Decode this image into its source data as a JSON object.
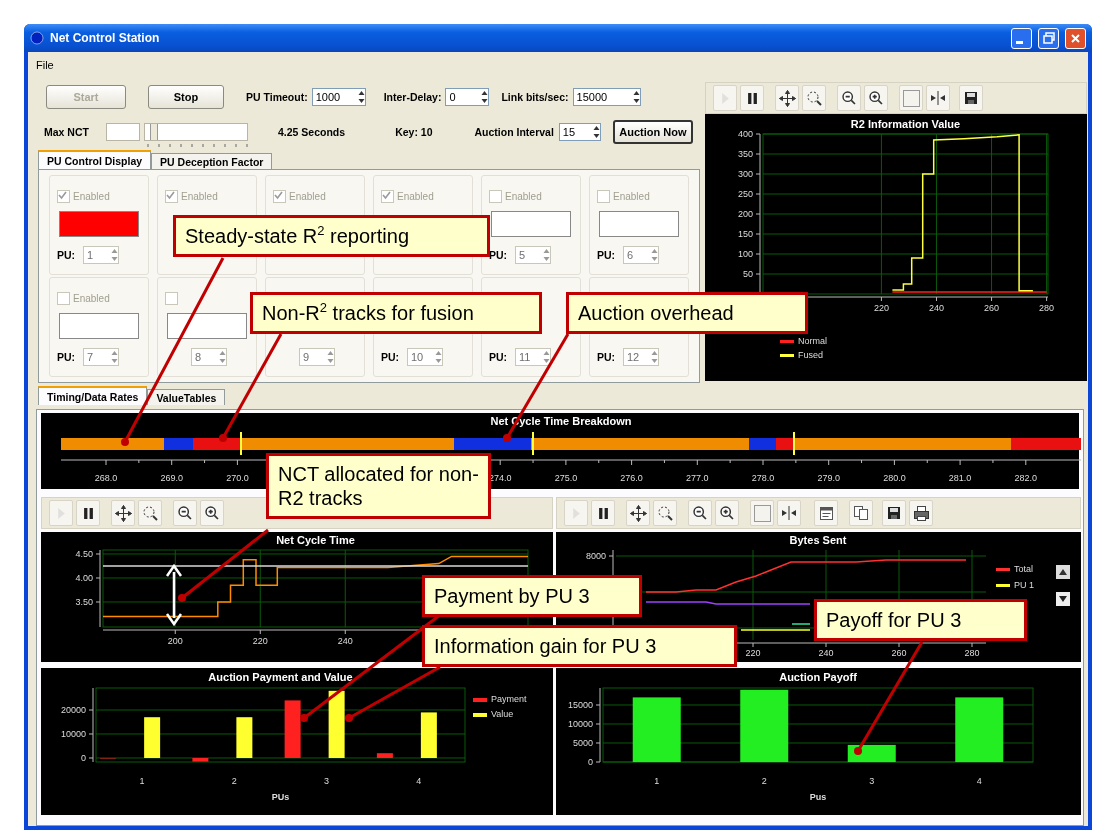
{
  "window": {
    "title": "Net Control Station"
  },
  "menu": [
    "File"
  ],
  "controls": {
    "start": {
      "label": "Start",
      "disabled": true
    },
    "stop": {
      "label": "Stop",
      "disabled": false
    },
    "pu_timeout": {
      "label": "PU Timeout:",
      "value": "1000"
    },
    "inter_delay": {
      "label": "Inter-Delay:",
      "value": "0"
    },
    "link_bits": {
      "label": "Link bits/sec:",
      "value": "15000"
    },
    "max_nct": {
      "label": "Max NCT",
      "level": 0.05,
      "reading": "4.25 Seconds"
    },
    "key": "Key: 10",
    "auction_interval": {
      "label": "Auction Interval",
      "value": "15"
    },
    "auction_now": {
      "label": "Auction Now"
    }
  },
  "top_tabs": [
    {
      "label": "PU Control Display",
      "selected": true
    },
    {
      "label": "PU Deception Factor",
      "selected": false
    }
  ],
  "pu_cells": [
    {
      "enabled_label": "Enabled",
      "checked": true,
      "color": "#ff0000",
      "pu_label": "PU:",
      "value": "1"
    },
    {
      "enabled_label": "Enabled",
      "checked": true
    },
    {
      "enabled_label": "Enabled",
      "checked": true
    },
    {
      "enabled_label": "Enabled",
      "checked": true
    },
    {
      "enabled_label": "Enabled",
      "checked": false,
      "color": "#ffffff",
      "pu_label": "PU:",
      "value": "5"
    },
    {
      "enabled_label": "Enabled",
      "checked": false,
      "color": "#ffffff",
      "pu_label": "PU:",
      "value": "6"
    },
    {
      "enabled_label": "Enabled",
      "checked": false,
      "color": "#ffffff",
      "pu_label": "PU:",
      "value": "7"
    },
    {
      "checked": false,
      "color": "#ffffff",
      "value": "8"
    },
    {
      "value": "9"
    },
    {
      "pu_label": "PU:",
      "value": "10"
    },
    {
      "pu_label": "PU:",
      "value": "11"
    },
    {
      "pu_label": "PU:",
      "value": "12"
    }
  ],
  "bottom_tabs": [
    {
      "label": "Timing/Data Rates",
      "selected": true
    },
    {
      "label": "ValueTables",
      "selected": false
    }
  ],
  "r2_panel": {
    "toolbar": [
      {
        "kind": "play",
        "disabled": true
      },
      {
        "kind": "pause",
        "disabled": false
      },
      {
        "kind": "move",
        "disabled": false
      },
      {
        "kind": "zoom-area",
        "disabled": false
      },
      {
        "kind": "zoom-out",
        "disabled": false
      },
      {
        "kind": "zoom-in",
        "disabled": false
      },
      {
        "kind": "blank",
        "disabled": false
      },
      {
        "kind": "split",
        "disabled": false
      },
      {
        "kind": "save",
        "disabled": false
      }
    ],
    "chart_data": {
      "type": "line",
      "title": "R2 Information Value",
      "grid": true,
      "legend": "bottom",
      "x": [
        224,
        228,
        228,
        231,
        231,
        235,
        235,
        239,
        239,
        250,
        262,
        270,
        270,
        275,
        280
      ],
      "xlim": [
        177,
        280.5
      ],
      "ylim": [
        0,
        400
      ],
      "xticks": [
        220,
        240,
        260,
        280
      ],
      "yticks": [
        50,
        100,
        150,
        200,
        250,
        300,
        350,
        400
      ],
      "series": [
        {
          "name": "Normal",
          "color": "#ff2020",
          "values": [
            5,
            5,
            5,
            5,
            5,
            5,
            5,
            5,
            5,
            5,
            5,
            5,
            5,
            5,
            5
          ]
        },
        {
          "name": "Fused",
          "color": "#ffff40",
          "values": [
            10,
            10,
            25,
            25,
            90,
            90,
            300,
            300,
            385,
            388,
            393,
            398,
            8,
            8,
            null
          ]
        }
      ]
    }
  },
  "timeline": {
    "title": "Net Cycle Time Breakdown",
    "tick_labels": [
      "268.0",
      "269.0",
      "270.0",
      "274.0",
      "275.0",
      "276.0",
      "277.0",
      "278.0",
      "279.0",
      "280.0",
      "281.0",
      "282.0"
    ]
  },
  "nct_panel": {
    "toolbar": [
      {
        "kind": "play",
        "disabled": true
      },
      {
        "kind": "pause",
        "disabled": false
      },
      {
        "kind": "move",
        "disabled": false
      },
      {
        "kind": "zoom-area",
        "disabled": false
      },
      {
        "kind": "zoom-out",
        "disabled": false
      },
      {
        "kind": "zoom-in",
        "disabled": false
      }
    ],
    "chart_data": {
      "type": "line",
      "title": "Net Cycle Time",
      "grid": true,
      "x": [
        183,
        210,
        210,
        213,
        213,
        216,
        216,
        219,
        219,
        224,
        224,
        250,
        262,
        265,
        283
      ],
      "xlim": [
        183,
        283
      ],
      "ylim": [
        2.979,
        4.583
      ],
      "xticks": [
        200,
        220,
        240
      ],
      "yticks": [
        {
          "value": 3.5,
          "label": "3.50"
        },
        {
          "value": 4,
          "label": "4.00"
        },
        {
          "value": 4.5,
          "label": "4.50"
        }
      ],
      "series": [
        {
          "color": "#ff8c00",
          "values": [
            3.2,
            3.2,
            3.5,
            3.5,
            3.85,
            3.85,
            4.38,
            4.38,
            3.85,
            3.85,
            4.22,
            4.22,
            4.3,
            4.45,
            4.45
          ]
        },
        {
          "color": "#d8d8d8",
          "values": [
            4.25,
            4.25,
            4.25,
            4.25,
            4.25,
            4.25,
            4.25,
            4.25,
            4.25,
            4.25,
            4.25,
            4.25,
            4.25,
            4.25,
            4.25
          ]
        }
      ]
    }
  },
  "bytes_panel": {
    "toolbar": [
      {
        "kind": "play",
        "disabled": true
      },
      {
        "kind": "pause",
        "disabled": false
      },
      {
        "kind": "move",
        "disabled": false
      },
      {
        "kind": "zoom-area",
        "disabled": false
      },
      {
        "kind": "zoom-out",
        "disabled": false
      },
      {
        "kind": "zoom-in",
        "disabled": false
      },
      {
        "kind": "blank",
        "disabled": false
      },
      {
        "kind": "split",
        "disabled": false
      },
      {
        "kind": "properties",
        "disabled": false
      },
      {
        "kind": "copy",
        "disabled": false
      },
      {
        "kind": "save",
        "disabled": false
      },
      {
        "kind": "print",
        "disabled": false
      }
    ],
    "graph": {
      "title": "Bytes Sent",
      "y_tick": "8000",
      "x_ticks": [
        "220",
        "240",
        "260",
        "280"
      ],
      "legend": [
        {
          "name": "Total",
          "color": "#ff3030"
        },
        {
          "name": "PU 1",
          "color": "#ffff30"
        }
      ]
    }
  },
  "payment_panel": {
    "chart_data": {
      "type": "bar",
      "title": "Auction Payment and Value",
      "grid": true,
      "legend": "right",
      "categories": [
        "1",
        "2",
        "3",
        "4"
      ],
      "xlabel": "PUs",
      "ylim": [
        -1670,
        29170
      ],
      "yticks": [
        0,
        10000,
        20000
      ],
      "series": [
        {
          "name": "Payment",
          "color": "#ff2020",
          "values": [
            0,
            -1500,
            24000,
            2000
          ]
        },
        {
          "name": "Value",
          "color": "#ffff30",
          "values": [
            17000,
            17000,
            28000,
            19000
          ]
        }
      ]
    }
  },
  "payoff_panel": {
    "chart_data": {
      "type": "bar",
      "title": "Auction Payoff",
      "grid": true,
      "categories": [
        "1",
        "2",
        "3",
        "4"
      ],
      "xlabel": "Pus",
      "ylim": [
        0,
        19470
      ],
      "yticks": [
        0,
        5000,
        10000,
        15000
      ],
      "series": [
        {
          "color": "#22ee22",
          "values": [
            17000,
            19000,
            4500,
            17000
          ]
        }
      ]
    }
  },
  "callouts": [
    {
      "text": "Steady-state R$^{2}$ reporting"
    },
    {
      "text": "Non-R$^{2}$ tracks for fusion"
    },
    {
      "text": "Auction overhead"
    },
    {
      "text": "NCT allocated for non-R2 tracks"
    },
    {
      "text": "Payment by PU 3"
    },
    {
      "text": "Information gain for PU 3"
    },
    {
      "text": "Payoff for PU 3"
    }
  ]
}
